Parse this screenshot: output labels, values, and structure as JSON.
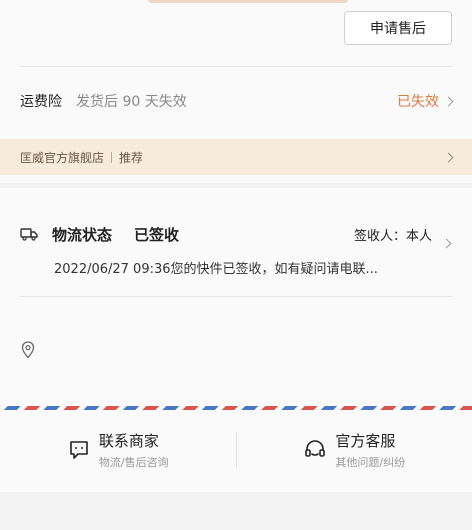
{
  "order": {
    "aftersale_button": "申请售后"
  },
  "insurance": {
    "title": "运费险",
    "description": "发货后 90 天失效",
    "status": "已失效",
    "status_color": "#e07a3c"
  },
  "store": {
    "name": "匡威官方旗舰店",
    "tag": "推荐"
  },
  "logistics": {
    "title": "物流状态",
    "state": "已签收",
    "receiver": "签收人：本人",
    "detail": "2022/06/27 09:36您的快件已签收，如有疑问请电联..."
  },
  "actions": {
    "contact_merchant": {
      "label": "联系商家",
      "sub": "物流/售后咨询"
    },
    "customer_service": {
      "label": "官方客服",
      "sub": "其他问题/纠纷"
    }
  },
  "icons": {
    "truck": "truck-icon",
    "pin": "location-pin-icon",
    "merchant": "chat-merchant-icon",
    "service": "headset-icon"
  }
}
